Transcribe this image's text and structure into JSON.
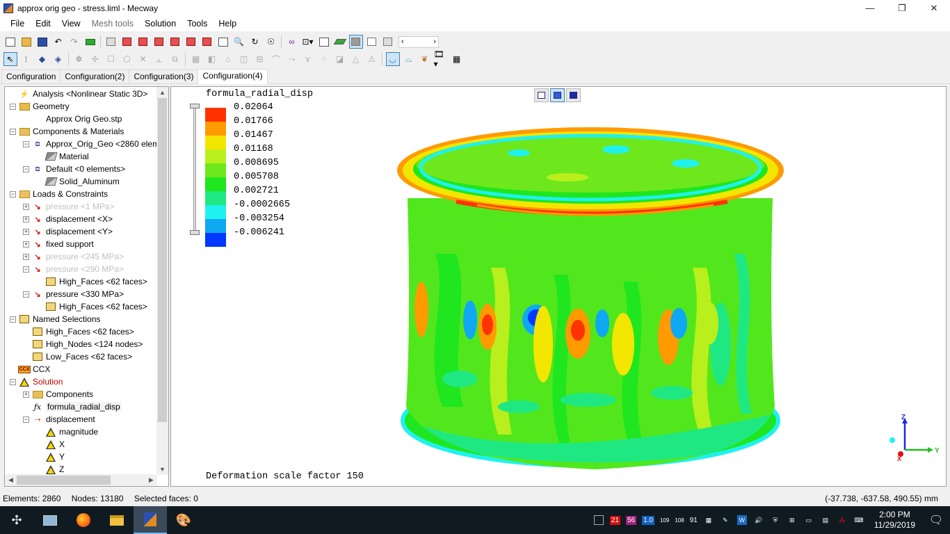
{
  "window": {
    "title": "approx orig geo - stress.liml - Mecway",
    "controls": [
      "—",
      "❐",
      "✕"
    ]
  },
  "menu": [
    {
      "label": "File",
      "enabled": true
    },
    {
      "label": "Edit",
      "enabled": true
    },
    {
      "label": "View",
      "enabled": true
    },
    {
      "label": "Mesh tools",
      "enabled": false
    },
    {
      "label": "Solution",
      "enabled": true
    },
    {
      "label": "Tools",
      "enabled": true
    },
    {
      "label": "Help",
      "enabled": true
    }
  ],
  "tabs": [
    {
      "label": "Configuration",
      "active": false
    },
    {
      "label": "Configuration(2)",
      "active": false
    },
    {
      "label": "Configuration(3)",
      "active": false
    },
    {
      "label": "Configuration(4)",
      "active": true
    }
  ],
  "tree": [
    {
      "label": "Analysis <Nonlinear Static 3D>",
      "icon": "analysis-icon",
      "level": 0,
      "expander": "",
      "style": ""
    },
    {
      "label": "Geometry",
      "icon": "folder-icon",
      "level": 0,
      "expander": "-",
      "style": ""
    },
    {
      "label": "Approx Orig Geo.stp",
      "icon": "file-icon",
      "level": 1,
      "expander": "",
      "style": ""
    },
    {
      "label": "Components & Materials",
      "icon": "components-icon",
      "level": 0,
      "expander": "-",
      "style": ""
    },
    {
      "label": "Approx_Orig_Geo <2860 elem",
      "icon": "component-icon",
      "level": 1,
      "expander": "-",
      "style": ""
    },
    {
      "label": "Material",
      "icon": "material-icon",
      "level": 2,
      "expander": "",
      "style": ""
    },
    {
      "label": "Default <0 elements>",
      "icon": "component-icon",
      "level": 1,
      "expander": "-",
      "style": ""
    },
    {
      "label": "Solid_Aluminum",
      "icon": "material-icon",
      "level": 2,
      "expander": "",
      "style": ""
    },
    {
      "label": "Loads & Constraints",
      "icon": "loads-icon",
      "level": 0,
      "expander": "-",
      "style": ""
    },
    {
      "label": "pressure <1 MPa>",
      "icon": "load-icon",
      "level": 1,
      "expander": "+",
      "style": "dim"
    },
    {
      "label": "displacement <X>",
      "icon": "load-icon",
      "level": 1,
      "expander": "+",
      "style": ""
    },
    {
      "label": "displacement <Y>",
      "icon": "load-icon",
      "level": 1,
      "expander": "+",
      "style": ""
    },
    {
      "label": "fixed support",
      "icon": "load-icon",
      "level": 1,
      "expander": "+",
      "style": ""
    },
    {
      "label": "pressure <245 MPa>",
      "icon": "load-icon",
      "level": 1,
      "expander": "+",
      "style": "dim"
    },
    {
      "label": "pressure <290 MPa>",
      "icon": "load-icon",
      "level": 1,
      "expander": "-",
      "style": "dim"
    },
    {
      "label": "High_Faces <62 faces>",
      "icon": "faces-icon",
      "level": 2,
      "expander": "",
      "style": ""
    },
    {
      "label": "pressure <330 MPa>",
      "icon": "load-icon",
      "level": 1,
      "expander": "-",
      "style": ""
    },
    {
      "label": "High_Faces <62 faces>",
      "icon": "faces-icon",
      "level": 2,
      "expander": "",
      "style": ""
    },
    {
      "label": "Named Selections",
      "icon": "faces-icon",
      "level": 0,
      "expander": "-",
      "style": ""
    },
    {
      "label": "High_Faces <62 faces>",
      "icon": "faces-icon",
      "level": 1,
      "expander": "",
      "style": ""
    },
    {
      "label": "High_Nodes <124 nodes>",
      "icon": "faces-icon",
      "level": 1,
      "expander": "",
      "style": ""
    },
    {
      "label": "Low_Faces <62 faces>",
      "icon": "faces-icon",
      "level": 1,
      "expander": "",
      "style": ""
    },
    {
      "label": "CCX",
      "icon": "ccx-icon",
      "level": 0,
      "expander": "",
      "style": ""
    },
    {
      "label": "Solution",
      "icon": "solution-icon",
      "level": 0,
      "expander": "-",
      "style": "red"
    },
    {
      "label": "Components",
      "icon": "components-icon",
      "level": 1,
      "expander": "+",
      "style": ""
    },
    {
      "label": "formula_radial_disp",
      "icon": "formula-icon",
      "level": 1,
      "expander": "",
      "style": "sel"
    },
    {
      "label": "displacement",
      "icon": "displacement-icon",
      "level": 1,
      "expander": "-",
      "style": ""
    },
    {
      "label": "magnitude",
      "icon": "triangle-icon",
      "level": 2,
      "expander": "",
      "style": ""
    },
    {
      "label": "X",
      "icon": "triangle-icon",
      "level": 2,
      "expander": "",
      "style": ""
    },
    {
      "label": "Y",
      "icon": "triangle-icon",
      "level": 2,
      "expander": "",
      "style": ""
    },
    {
      "label": "Z",
      "icon": "triangle-icon",
      "level": 2,
      "expander": "",
      "style": ""
    }
  ],
  "viewport": {
    "title": "formula_radial_disp",
    "footer": "Deformation scale factor 150",
    "legend": [
      {
        "value": "0.02064",
        "color": "#ff3300"
      },
      {
        "value": "0.01766",
        "color": "#ff9a00"
      },
      {
        "value": "0.01467",
        "color": "#f2e600"
      },
      {
        "value": "0.01168",
        "color": "#b9ef1c"
      },
      {
        "value": "0.008695",
        "color": "#6ee81c"
      },
      {
        "value": "0.005708",
        "color": "#1fe61f"
      },
      {
        "value": "0.002721",
        "color": "#1fe883"
      },
      {
        "value": "-0.0002665",
        "color": "#1ff2ee"
      },
      {
        "value": "-0.003254",
        "color": "#0fa8f2"
      },
      {
        "value": "-0.006241",
        "color": "#0038ff"
      }
    ],
    "axes": {
      "x": "X",
      "y": "Y",
      "z": "Z"
    }
  },
  "status": {
    "elements": "Elements: 2860",
    "nodes": "Nodes: 13180",
    "selected": "Selected faces: 0",
    "coords": "(-37.738, -637.58, 490.55) mm"
  },
  "taskbar": {
    "apps": [
      "start-icon",
      "computer-icon",
      "firefox-icon",
      "explorer-icon",
      "mecway-icon",
      "paint-icon"
    ],
    "tray_numbers": [
      "21",
      "56",
      "1.0",
      "109",
      "108",
      "91"
    ],
    "time": "2:00 PM",
    "date": "11/29/2019"
  }
}
